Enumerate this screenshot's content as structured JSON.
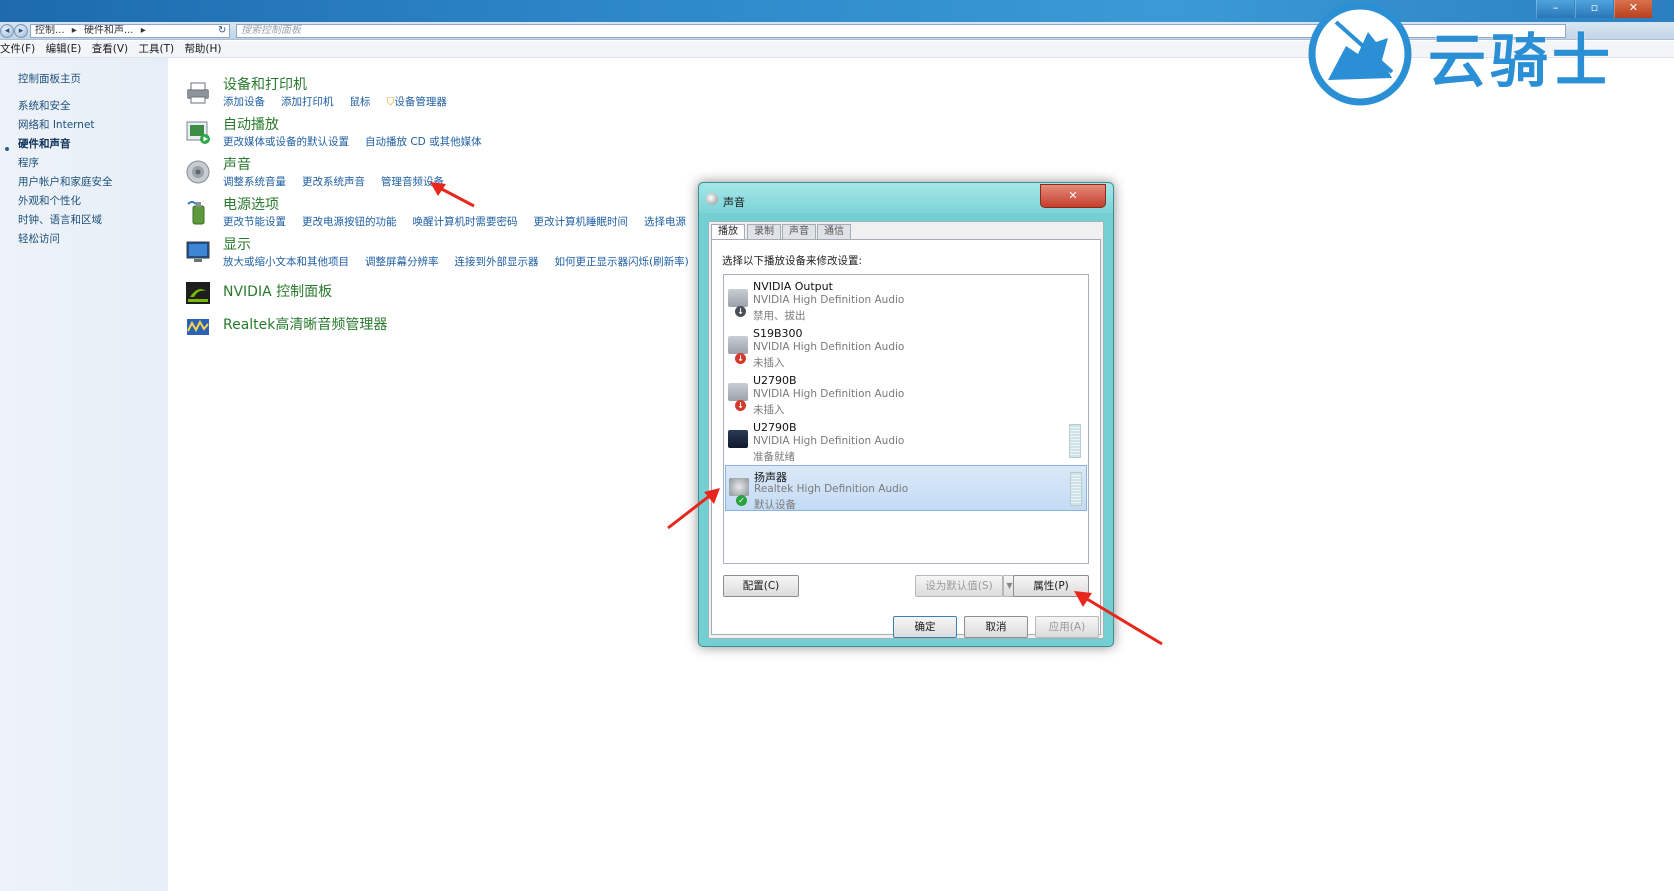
{
  "window": {
    "minimize": "–",
    "maximize": "▫",
    "close": "✕",
    "breadcrumb": [
      "控制...",
      "硬件和声...",
      "▸"
    ],
    "search_placeholder": "搜索控制面板"
  },
  "menubar": [
    "文件(F)",
    "编辑(E)",
    "查看(V)",
    "工具(T)",
    "帮助(H)"
  ],
  "sidebar": {
    "items": [
      {
        "label": "控制面板主页",
        "active": false
      },
      {
        "label": "系统和安全",
        "active": false
      },
      {
        "label": "网络和 Internet",
        "active": false
      },
      {
        "label": "硬件和声音",
        "active": true
      },
      {
        "label": "程序",
        "active": false
      },
      {
        "label": "用户帐户和家庭安全",
        "active": false
      },
      {
        "label": "外观和个性化",
        "active": false
      },
      {
        "label": "时钟、语言和区域",
        "active": false
      },
      {
        "label": "轻松访问",
        "active": false
      }
    ]
  },
  "categories": [
    {
      "title": "设备和打印机",
      "icon": "printer-icon",
      "links": [
        "添加设备",
        "添加打印机",
        "鼠标",
        "设备管理器"
      ]
    },
    {
      "title": "自动播放",
      "icon": "autoplay-icon",
      "links": [
        "更改媒体或设备的默认设置",
        "自动播放 CD 或其他媒体"
      ]
    },
    {
      "title": "声音",
      "icon": "speaker-icon",
      "links": [
        "调整系统音量",
        "更改系统声音",
        "管理音频设备"
      ]
    },
    {
      "title": "电源选项",
      "icon": "power-icon",
      "links": [
        "更改节能设置",
        "更改电源按钮的功能",
        "唤醒计算机时需要密码",
        "更改计算机睡眠时间",
        "选择电源"
      ]
    },
    {
      "title": "显示",
      "icon": "display-icon",
      "links": [
        "放大或缩小文本和其他项目",
        "调整屏幕分辨率",
        "连接到外部显示器",
        "如何更正显示器闪烁(刷新率)"
      ]
    },
    {
      "title": "NVIDIA 控制面板",
      "icon": "nvidia-icon",
      "links": []
    },
    {
      "title": "Realtek高清晰音频管理器",
      "icon": "realtek-icon",
      "links": []
    }
  ],
  "dialog": {
    "title": "声音",
    "close": "✕",
    "tabs": [
      {
        "label": "播放",
        "active": true
      },
      {
        "label": "录制",
        "active": false
      },
      {
        "label": "声音",
        "active": false
      },
      {
        "label": "通信",
        "active": false
      }
    ],
    "instruction": "选择以下播放设备来修改设置:",
    "devices": [
      {
        "name": "NVIDIA Output",
        "driver": "NVIDIA High Definition Audio",
        "status": "禁用、拔出",
        "badge": "down-arrow-icon",
        "selected": false
      },
      {
        "name": "S19B300",
        "driver": "NVIDIA High Definition Audio",
        "status": "未插入",
        "badge": "unplugged-icon",
        "selected": false
      },
      {
        "name": "U2790B",
        "driver": "NVIDIA High Definition Audio",
        "status": "未插入",
        "badge": "unplugged-icon",
        "selected": false
      },
      {
        "name": "U2790B",
        "driver": "NVIDIA High Definition Audio",
        "status": "准备就绪",
        "badge": "",
        "selected": false
      },
      {
        "name": "扬声器",
        "driver": "Realtek High Definition Audio",
        "status": "默认设备",
        "badge": "check-icon",
        "selected": true
      }
    ],
    "buttons": {
      "configure": "配置(C)",
      "set_default": "设为默认值(S)",
      "properties": "属性(P)",
      "ok": "确定",
      "cancel": "取消",
      "apply": "应用(A)"
    }
  },
  "watermark": {
    "text": "云骑士"
  },
  "colors": {
    "category_title": "#2a7a2e",
    "link": "#1e5fa3",
    "dialog_frame": "#74cfd3",
    "annotation_arrow": "#e8261c",
    "watermark": "#2b8fd6"
  }
}
